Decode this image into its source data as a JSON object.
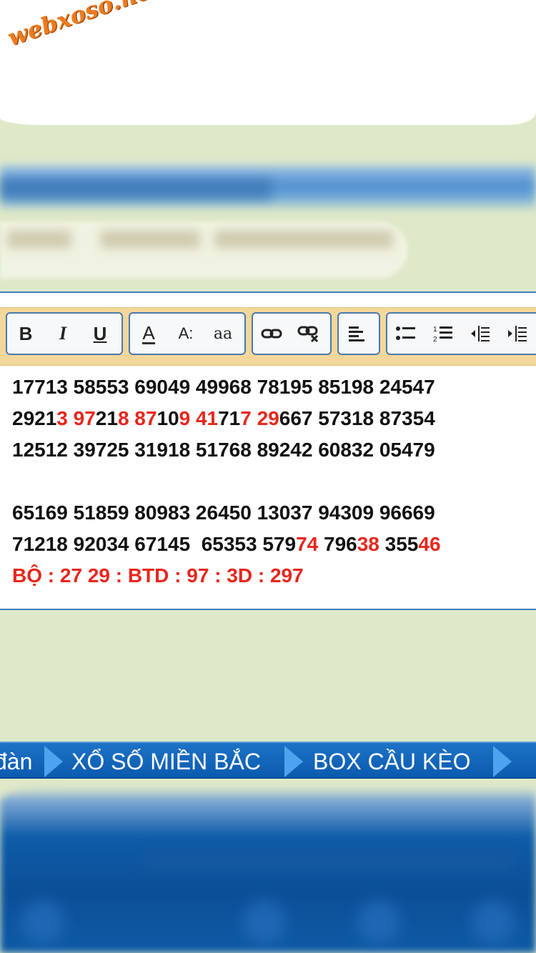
{
  "watermark": {
    "text": "webxoso.net",
    "color": "#f07a1e"
  },
  "toolbar": {
    "bold_label": "B",
    "italic_label": "I",
    "underline_label": "U",
    "font_color_label": "A",
    "font_size_label": "A:",
    "font_family_label": "aa"
  },
  "content": {
    "rows": [
      [
        {
          "t": "17713 58553 69049 49968 78195 85198 24547",
          "red": false
        }
      ],
      [
        {
          "t": "2921",
          "red": false
        },
        {
          "t": "3 97",
          "red": true
        },
        {
          "t": "21",
          "red": false
        },
        {
          "t": "8 87",
          "red": true
        },
        {
          "t": "10",
          "red": false
        },
        {
          "t": "9 41",
          "red": true
        },
        {
          "t": "71",
          "red": false
        },
        {
          "t": "7 29",
          "red": true
        },
        {
          "t": "667 57318 87354",
          "red": false
        }
      ],
      [
        {
          "t": "12512 39725 31918 51768 89242 60832 05479",
          "red": false
        }
      ],
      [],
      [
        {
          "t": "65169 51859 80983 26450 13037 94309 96669",
          "red": false
        }
      ],
      [
        {
          "t": "71218 92034 67145  65353 579",
          "red": false
        },
        {
          "t": "74",
          "red": true
        },
        {
          "t": " 796",
          "red": false
        },
        {
          "t": "38",
          "red": true
        },
        {
          "t": " 355",
          "red": false
        },
        {
          "t": "46",
          "red": true
        }
      ],
      [
        {
          "t": "BỘ : 27 29 : BTD : 97 : 3D : 297",
          "red": true
        }
      ]
    ],
    "highlight_color": "#e8261c"
  },
  "nav": {
    "items": [
      "đàn",
      "XỔ SỐ MIỀN BẮC",
      "BOX CẦU KÈO"
    ]
  }
}
